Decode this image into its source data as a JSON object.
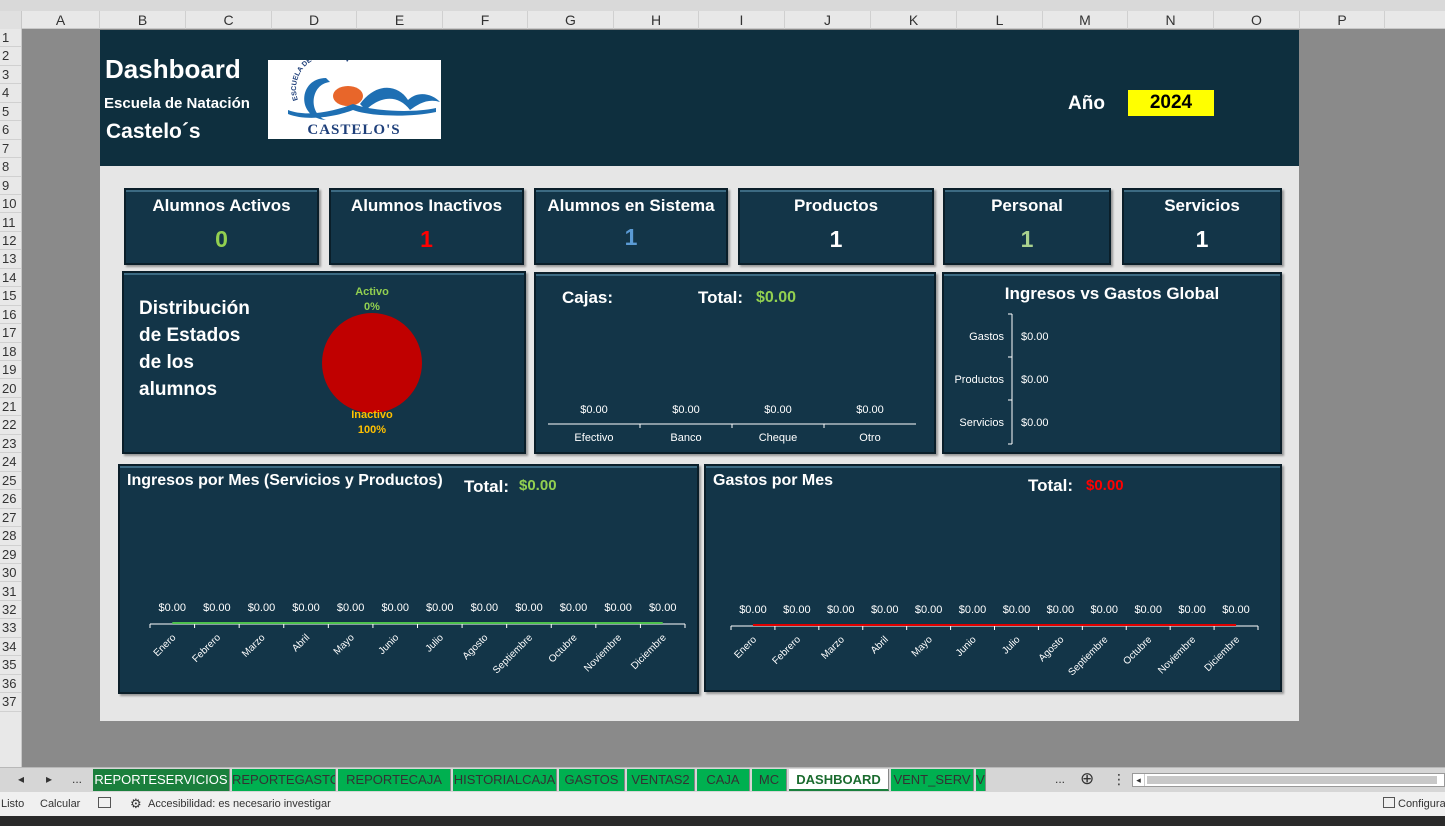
{
  "columns": [
    "A",
    "B",
    "C",
    "D",
    "E",
    "F",
    "G",
    "H",
    "I",
    "J",
    "K",
    "L",
    "M",
    "N",
    "O",
    "P"
  ],
  "rows": [
    "1",
    "2",
    "3",
    "4",
    "5",
    "6",
    "7",
    "8",
    "9",
    "10",
    "11",
    "12",
    "13",
    "14",
    "15",
    "16",
    "17",
    "18",
    "19",
    "20",
    "21",
    "22",
    "23",
    "24",
    "25",
    "26",
    "27",
    "28",
    "29",
    "30",
    "31",
    "32",
    "33",
    "34",
    "35",
    "36",
    "37"
  ],
  "header": {
    "title": "Dashboard",
    "subtitle": "Escuela de Natación",
    "subtitle2": "Castelo´s",
    "logo_top": "ESCUELA DE NATACION",
    "logo_text": "CASTELO'S",
    "year_label": "Año",
    "year_value": "2024"
  },
  "kpis": [
    {
      "label": "Alumnos Activos",
      "value": "0",
      "color": "#92d050"
    },
    {
      "label": "Alumnos Inactivos",
      "value": "1",
      "color": "#ff0000"
    },
    {
      "label": "Alumnos en Sistema",
      "value": "1",
      "color": "#5b9bd5"
    },
    {
      "label": "Productos",
      "value": "1",
      "color": "#ffffff"
    },
    {
      "label": "Personal",
      "value": "1",
      "color": "#a9d18e"
    },
    {
      "label": "Servicios",
      "value": "1",
      "color": "#ffffff"
    }
  ],
  "distribution": {
    "title_lines": [
      "Distribución",
      "de Estados",
      "de los",
      "alumnos"
    ]
  },
  "cajas": {
    "title": "Cajas:",
    "total_label": "Total:",
    "total_value": "$0.00"
  },
  "global": {
    "title": "Ingresos vs Gastos Global"
  },
  "ingresos_mes": {
    "title": "Ingresos por Mes (Servicios y Productos)",
    "total_label": "Total:",
    "total_value": "$0.00"
  },
  "gastos_mes": {
    "title": "Gastos por Mes",
    "total_label": "Total:",
    "total_value": "$0.00"
  },
  "chart_data": [
    {
      "type": "pie",
      "categories": [
        "Activo",
        "Inactivo"
      ],
      "values": [
        0,
        100
      ],
      "labels": [
        "0%",
        "100%"
      ],
      "colors": [
        "#92d050",
        "#c00000"
      ]
    },
    {
      "type": "bar",
      "categories": [
        "Efectivo",
        "Banco",
        "Cheque",
        "Otro"
      ],
      "values": [
        0,
        0,
        0,
        0
      ],
      "data_labels": [
        "$0.00",
        "$0.00",
        "$0.00",
        "$0.00"
      ]
    },
    {
      "type": "bar",
      "orientation": "horizontal",
      "categories": [
        "Gastos",
        "Productos",
        "Servicios"
      ],
      "values": [
        0,
        0,
        0
      ],
      "data_labels": [
        "$0.00",
        "$0.00",
        "$0.00"
      ]
    },
    {
      "type": "line",
      "categories": [
        "Enero",
        "Febrero",
        "Marzo",
        "Abril",
        "Mayo",
        "Junio",
        "Julio",
        "Agosto",
        "Septiembre",
        "Octubre",
        "Noviembre",
        "Diciembre"
      ],
      "values": [
        0,
        0,
        0,
        0,
        0,
        0,
        0,
        0,
        0,
        0,
        0,
        0
      ],
      "data_labels": [
        "$0.00",
        "$0.00",
        "$0.00",
        "$0.00",
        "$0.00",
        "$0.00",
        "$0.00",
        "$0.00",
        "$0.00",
        "$0.00",
        "$0.00",
        "$0.00"
      ],
      "color": "#4ec24e"
    },
    {
      "type": "line",
      "categories": [
        "Enero",
        "Febrero",
        "Marzo",
        "Abril",
        "Mayo",
        "Junio",
        "Julio",
        "Agosto",
        "Septiembre",
        "Octubre",
        "Noviembre",
        "Diciembre"
      ],
      "values": [
        0,
        0,
        0,
        0,
        0,
        0,
        0,
        0,
        0,
        0,
        0,
        0
      ],
      "data_labels": [
        "$0.00",
        "$0.00",
        "$0.00",
        "$0.00",
        "$0.00",
        "$0.00",
        "$0.00",
        "$0.00",
        "$0.00",
        "$0.00",
        "$0.00",
        "$0.00"
      ],
      "color": "#e00000"
    }
  ],
  "tabs": [
    {
      "label": "REPORTESERVICIOS",
      "style": "dark"
    },
    {
      "label": "REPORTEGASTOS",
      "style": "green"
    },
    {
      "label": "REPORTECAJA",
      "style": "green"
    },
    {
      "label": "HISTORIALCAJA",
      "style": "green"
    },
    {
      "label": "GASTOS",
      "style": "green"
    },
    {
      "label": "VENTAS2",
      "style": "green"
    },
    {
      "label": "CAJA",
      "style": "green"
    },
    {
      "label": "MC",
      "style": "green"
    },
    {
      "label": "DASHBOARD",
      "style": "active"
    },
    {
      "label": "VENT_SERV",
      "style": "green"
    },
    {
      "label": "V",
      "style": "green"
    }
  ],
  "tab_nav": {
    "prev": "◂",
    "next": "▸",
    "more": "...",
    "more_right": "...",
    "add": "⊕",
    "menu": "⋮"
  },
  "status": {
    "ready": "Listo",
    "calc": "Calcular",
    "accessibility": "Accesibilidad: es necesario investigar",
    "config": "Configura"
  }
}
